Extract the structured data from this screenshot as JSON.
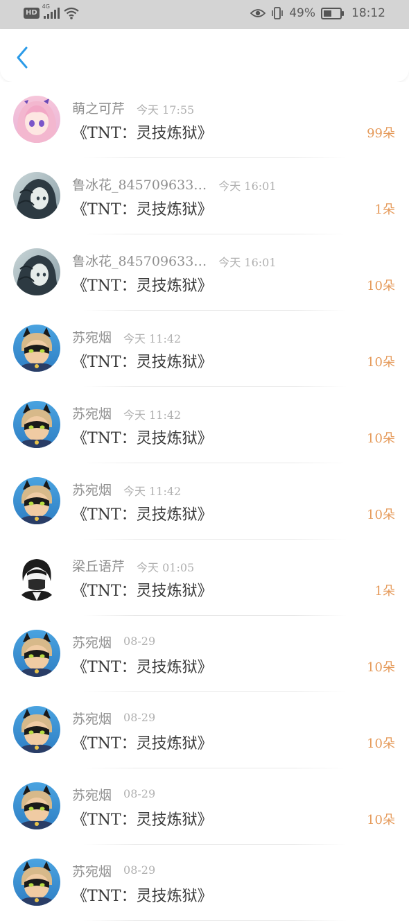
{
  "status_bar": {
    "badge": "HD",
    "network": "4G",
    "battery_percent": "49%",
    "battery_level": 0.49,
    "clock": "18:12",
    "icons": [
      "hd-icon",
      "signal-icon",
      "wifi-icon",
      "eye-icon",
      "vibrate-icon",
      "battery-icon"
    ]
  },
  "header": {
    "back_icon": "chevron-left-icon",
    "accent_color": "#2b9be8"
  },
  "colors": {
    "name": "#8f8f8f",
    "time": "#b0b0b0",
    "title": "#3a3a3a",
    "count": "#e59a5a"
  },
  "records": [
    {
      "name": "萌之可芹",
      "time": "今天 17:55",
      "title": "《TNT：灵技炼狱》",
      "count": "99朵",
      "avatar": "anime-girl-pink"
    },
    {
      "name": "鲁冰花_845709633…",
      "time": "今天 16:01",
      "title": "《TNT：灵技炼狱》",
      "count": "1朵",
      "avatar": "anime-girl-dark"
    },
    {
      "name": "鲁冰花_845709633…",
      "time": "今天 16:01",
      "title": "《TNT：灵技炼狱》",
      "count": "10朵",
      "avatar": "anime-girl-dark"
    },
    {
      "name": "苏宛烟",
      "time": "今天 11:42",
      "title": "《TNT：灵技炼狱》",
      "count": "10朵",
      "avatar": "cat-mask-boy"
    },
    {
      "name": "苏宛烟",
      "time": "今天 11:42",
      "title": "《TNT：灵技炼狱》",
      "count": "10朵",
      "avatar": "cat-mask-boy"
    },
    {
      "name": "苏宛烟",
      "time": "今天 11:42",
      "title": "《TNT：灵技炼狱》",
      "count": "10朵",
      "avatar": "cat-mask-boy"
    },
    {
      "name": "梁丘语芹",
      "time": "今天 01:05",
      "title": "《TNT：灵技炼狱》",
      "count": "1朵",
      "avatar": "masked-boy-bw"
    },
    {
      "name": "苏宛烟",
      "time": "08-29",
      "title": "《TNT：灵技炼狱》",
      "count": "10朵",
      "avatar": "cat-mask-boy"
    },
    {
      "name": "苏宛烟",
      "time": "08-29",
      "title": "《TNT：灵技炼狱》",
      "count": "10朵",
      "avatar": "cat-mask-boy"
    },
    {
      "name": "苏宛烟",
      "time": "08-29",
      "title": "《TNT：灵技炼狱》",
      "count": "10朵",
      "avatar": "cat-mask-boy"
    },
    {
      "name": "苏宛烟",
      "time": "08-29",
      "title": "《TNT：灵技炼狱》",
      "count": "",
      "avatar": "cat-mask-boy"
    }
  ]
}
